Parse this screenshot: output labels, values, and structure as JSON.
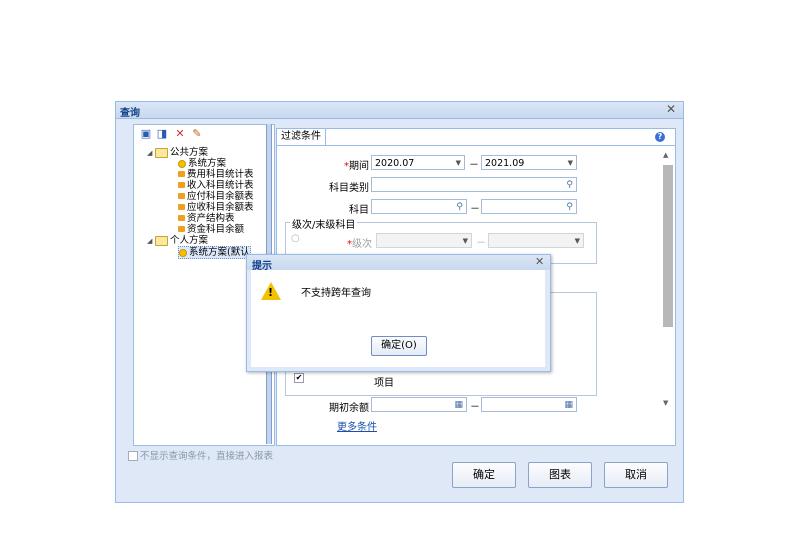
{
  "dialog": {
    "title": "查询"
  },
  "tree": {
    "public_group": "公共方案",
    "public_items": [
      "系统方案",
      "费用科目统计表",
      "收入科目统计表",
      "应付科目余额表",
      "应收科目余额表",
      "资产结构表",
      "资金科目余额"
    ],
    "personal_group": "个人方案",
    "personal_items": [
      "系统方案(默认"
    ]
  },
  "filter": {
    "tab_label": "过滤条件",
    "period_label": "期间",
    "period_from": "2020.07",
    "period_to": "2021.09",
    "category_label": "科目类别",
    "subject_label": "科目",
    "level_group": "级次/末级科目",
    "level_label": "级次",
    "item_label": "项目",
    "opening_label": "期初余额",
    "more_link": "更多条件",
    "dash": "－"
  },
  "skip_label": "不显示查询条件，直接进入报表",
  "buttons": {
    "ok": "确定",
    "chart": "图表",
    "cancel": "取消"
  },
  "alert": {
    "title": "提示",
    "message": "不支持跨年查询",
    "ok": "确定(O)"
  },
  "icons": [
    "save-icon",
    "save-as-icon",
    "delete-icon",
    "edit-icon",
    "help-icon",
    "warning-icon",
    "close-icon"
  ]
}
